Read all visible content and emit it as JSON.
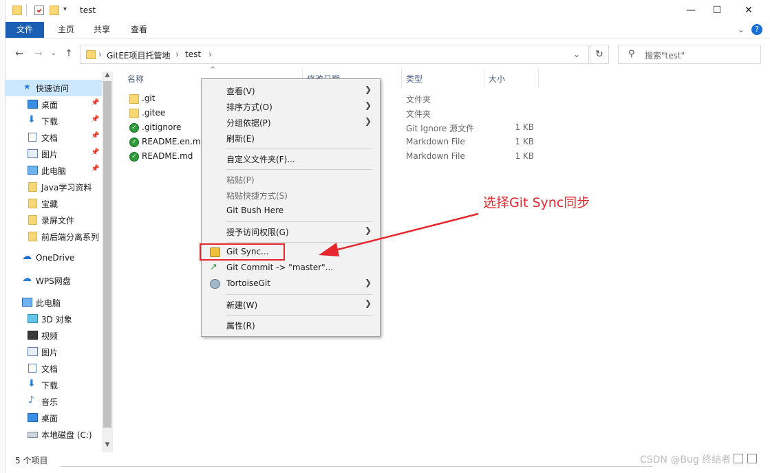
{
  "window": {
    "title": "test",
    "controls": [
      "minimize-icon",
      "maximize-icon",
      "close-icon"
    ]
  },
  "ribbon": {
    "tabs": [
      "文件",
      "主页",
      "共享",
      "查看"
    ]
  },
  "address": {
    "crumbs": [
      "GitEE项目托管地",
      "test"
    ],
    "search_placeholder": "搜索\"test\""
  },
  "nav": {
    "items": [
      {
        "label": "快速访问",
        "icon": "star-icon"
      },
      {
        "label": "桌面",
        "icon": "desktop-icon",
        "pinned": true
      },
      {
        "label": "下载",
        "icon": "download-icon",
        "pinned": true
      },
      {
        "label": "文档",
        "icon": "document-icon",
        "pinned": true
      },
      {
        "label": "图片",
        "icon": "picture-icon",
        "pinned": true
      },
      {
        "label": "此电脑",
        "icon": "computer-icon",
        "pinned": true
      },
      {
        "label": "Java学习资料",
        "icon": "folder-icon"
      },
      {
        "label": "宝藏",
        "icon": "folder-icon"
      },
      {
        "label": "录屏文件",
        "icon": "folder-icon"
      },
      {
        "label": "前后端分离系列",
        "icon": "git-folder-icon"
      },
      {
        "label": "OneDrive",
        "icon": "cloud-icon"
      },
      {
        "label": "WPS网盘",
        "icon": "cloud-icon"
      },
      {
        "label": "此电脑",
        "icon": "computer-icon"
      },
      {
        "label": "3D 对象",
        "icon": "cube-icon"
      },
      {
        "label": "视频",
        "icon": "video-icon"
      },
      {
        "label": "图片",
        "icon": "picture-icon"
      },
      {
        "label": "文档",
        "icon": "document-icon"
      },
      {
        "label": "下载",
        "icon": "download-icon"
      },
      {
        "label": "音乐",
        "icon": "music-icon"
      },
      {
        "label": "桌面",
        "icon": "desktop-icon"
      },
      {
        "label": "本地磁盘 (C:)",
        "icon": "drive-icon"
      }
    ]
  },
  "files": {
    "columns": [
      "名称",
      "修改日期",
      "类型",
      "大小"
    ],
    "rows": [
      {
        "name": ".git",
        "type": "文件夹",
        "size": ""
      },
      {
        "name": ".gitee",
        "type": "文件夹",
        "size": ""
      },
      {
        "name": ".gitignore",
        "type": "Git Ignore 源文件",
        "size": "1 KB"
      },
      {
        "name": "README.en.md",
        "type": "Markdown File",
        "size": "1 KB"
      },
      {
        "name": "README.md",
        "type": "Markdown File",
        "size": "1 KB"
      }
    ]
  },
  "status": {
    "count": "5 个项目"
  },
  "context_menu": {
    "items": [
      {
        "label": "查看(V)",
        "submenu": true
      },
      {
        "label": "排序方式(O)",
        "submenu": true
      },
      {
        "label": "分组依据(P)",
        "submenu": true
      },
      {
        "label": "刷新(E)"
      },
      {
        "label": "自定义文件夹(F)..."
      },
      {
        "label": "粘贴(P)",
        "disabled": true
      },
      {
        "label": "粘贴快捷方式(S)",
        "disabled": true
      },
      {
        "label": "Git Bush Here"
      },
      {
        "label": "授予访问权限(G)",
        "submenu": true
      },
      {
        "label": "Git Sync...",
        "icon": "git-sync-icon"
      },
      {
        "label": "Git Commit -> \"master\"...",
        "icon": "git-commit-icon"
      },
      {
        "label": "TortoiseGit",
        "icon": "tortoisegit-icon",
        "submenu": true
      },
      {
        "label": "新建(W)",
        "submenu": true
      },
      {
        "label": "属性(R)"
      }
    ]
  },
  "annotation": {
    "text": "选择Git Sync同步",
    "color": "#e8262d"
  },
  "watermark": "CSDN @Bug 终结者"
}
